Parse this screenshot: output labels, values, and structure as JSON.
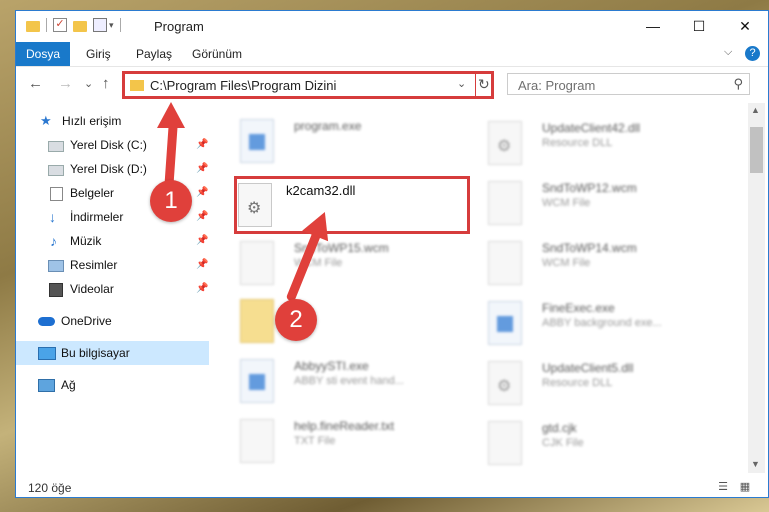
{
  "window": {
    "title": "Program"
  },
  "window_controls": {
    "minimize": "—",
    "maximize": "☐",
    "close": "✕"
  },
  "ribbon": {
    "tabs": [
      "Dosya",
      "Giriş",
      "Paylaş",
      "Görünüm"
    ],
    "collapse": "⌵",
    "help": "?"
  },
  "nav": {
    "back": "←",
    "forward": "→",
    "recent": "⌄",
    "up": "↑"
  },
  "address": {
    "path": "C:\\Program Files\\Program Dizini",
    "dropdown": "⌄",
    "refresh": "↻"
  },
  "search": {
    "placeholder": "Ara: Program",
    "icon": "⚲"
  },
  "sidebar": {
    "items": [
      {
        "label": "Hızlı erişim",
        "icon": "star-icon"
      },
      {
        "label": "Yerel Disk (C:)",
        "icon": "drive-icon",
        "pinned": true
      },
      {
        "label": "Yerel Disk (D:)",
        "icon": "drive-icon",
        "pinned": true
      },
      {
        "label": "Belgeler",
        "icon": "documents-icon",
        "pinned": true
      },
      {
        "label": "İndirmeler",
        "icon": "download-icon",
        "pinned": true
      },
      {
        "label": "Müzik",
        "icon": "music-icon",
        "pinned": true
      },
      {
        "label": "Resimler",
        "icon": "pictures-icon",
        "pinned": true
      },
      {
        "label": "Videolar",
        "icon": "videos-icon",
        "pinned": true
      },
      {
        "label": "OneDrive",
        "icon": "cloud-icon"
      },
      {
        "label": "Bu bilgisayar",
        "icon": "computer-icon",
        "selected": true
      },
      {
        "label": "Ağ",
        "icon": "network-icon"
      }
    ],
    "pin_glyph": "📌"
  },
  "files": {
    "highlighted": {
      "name": "k2cam32.dll"
    },
    "left": [
      {
        "name": "program.exe",
        "type": ""
      },
      {
        "name": "SndToWP15.wcm",
        "type": "WCM File"
      },
      {
        "name": "..",
        "type": ""
      },
      {
        "name": "AbbyySTI.exe",
        "type": "ABBY sti event hand..."
      },
      {
        "name": "help.fineReader.txt",
        "type": "TXT File"
      }
    ],
    "right": [
      {
        "name": "UpdateClient42.dll",
        "type": "Resource DLL"
      },
      {
        "name": "SndToWP12.wcm",
        "type": "WCM File"
      },
      {
        "name": "SndToWP14.wcm",
        "type": "WCM File"
      },
      {
        "name": "FineExec.exe",
        "type": "ABBY background exe..."
      },
      {
        "name": "UpdateClient5.dll",
        "type": "Resource DLL"
      },
      {
        "name": "gtd.cjk",
        "type": "CJK File"
      }
    ]
  },
  "status": {
    "count": "120 öğe"
  },
  "annotations": {
    "step1": "1",
    "step2": "2"
  },
  "colors": {
    "accent": "#1979ca",
    "highlight": "#d63c3c",
    "selected": "#cce8ff"
  }
}
